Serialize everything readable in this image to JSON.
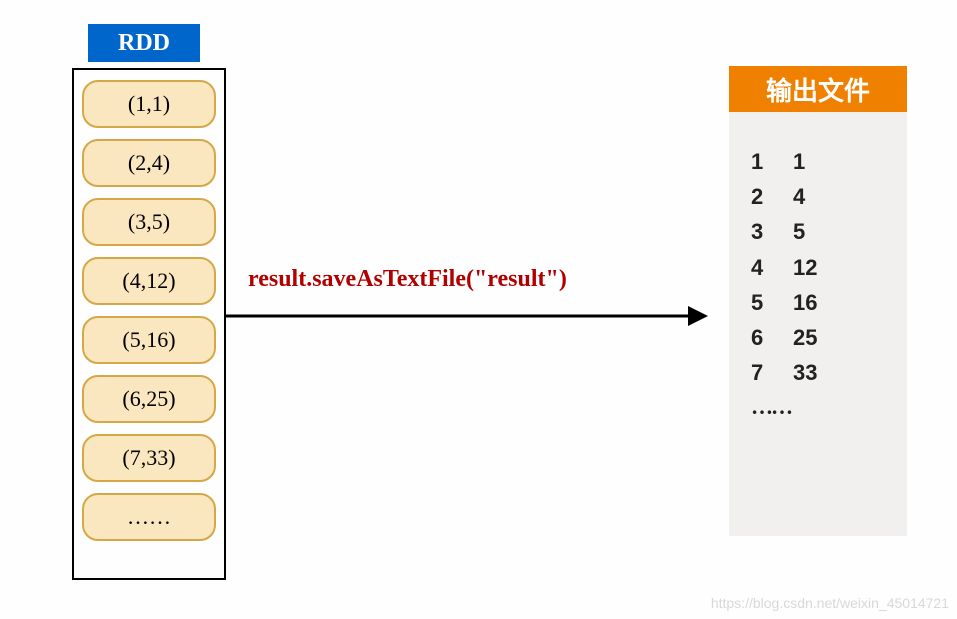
{
  "rdd": {
    "header": "RDD",
    "items": [
      "(1,1)",
      "(2,4)",
      "(3,5)",
      "(4,12)",
      "(5,16)",
      "(6,25)",
      "(7,33)",
      "……"
    ]
  },
  "arrow": {
    "label": "result.saveAsTextFile(\"result\")"
  },
  "output": {
    "header": "输出文件",
    "rows": [
      {
        "k": "1",
        "v": "1"
      },
      {
        "k": "2",
        "v": "4"
      },
      {
        "k": "3",
        "v": "5"
      },
      {
        "k": "4",
        "v": "12"
      },
      {
        "k": "5",
        "v": "16"
      },
      {
        "k": "6",
        "v": "25"
      },
      {
        "k": "7",
        "v": "33"
      }
    ],
    "ellipsis": "……"
  },
  "watermark": "https://blog.csdn.net/weixin_45014721",
  "chart_data": {
    "type": "table",
    "title": "RDD saveAsTextFile output mapping",
    "operation": "result.saveAsTextFile(\"result\")",
    "input_label": "RDD",
    "output_label": "输出文件",
    "records": [
      {
        "key": 1,
        "value": 1
      },
      {
        "key": 2,
        "value": 4
      },
      {
        "key": 3,
        "value": 5
      },
      {
        "key": 4,
        "value": 12
      },
      {
        "key": 5,
        "value": 16
      },
      {
        "key": 6,
        "value": 25
      },
      {
        "key": 7,
        "value": 33
      }
    ]
  }
}
